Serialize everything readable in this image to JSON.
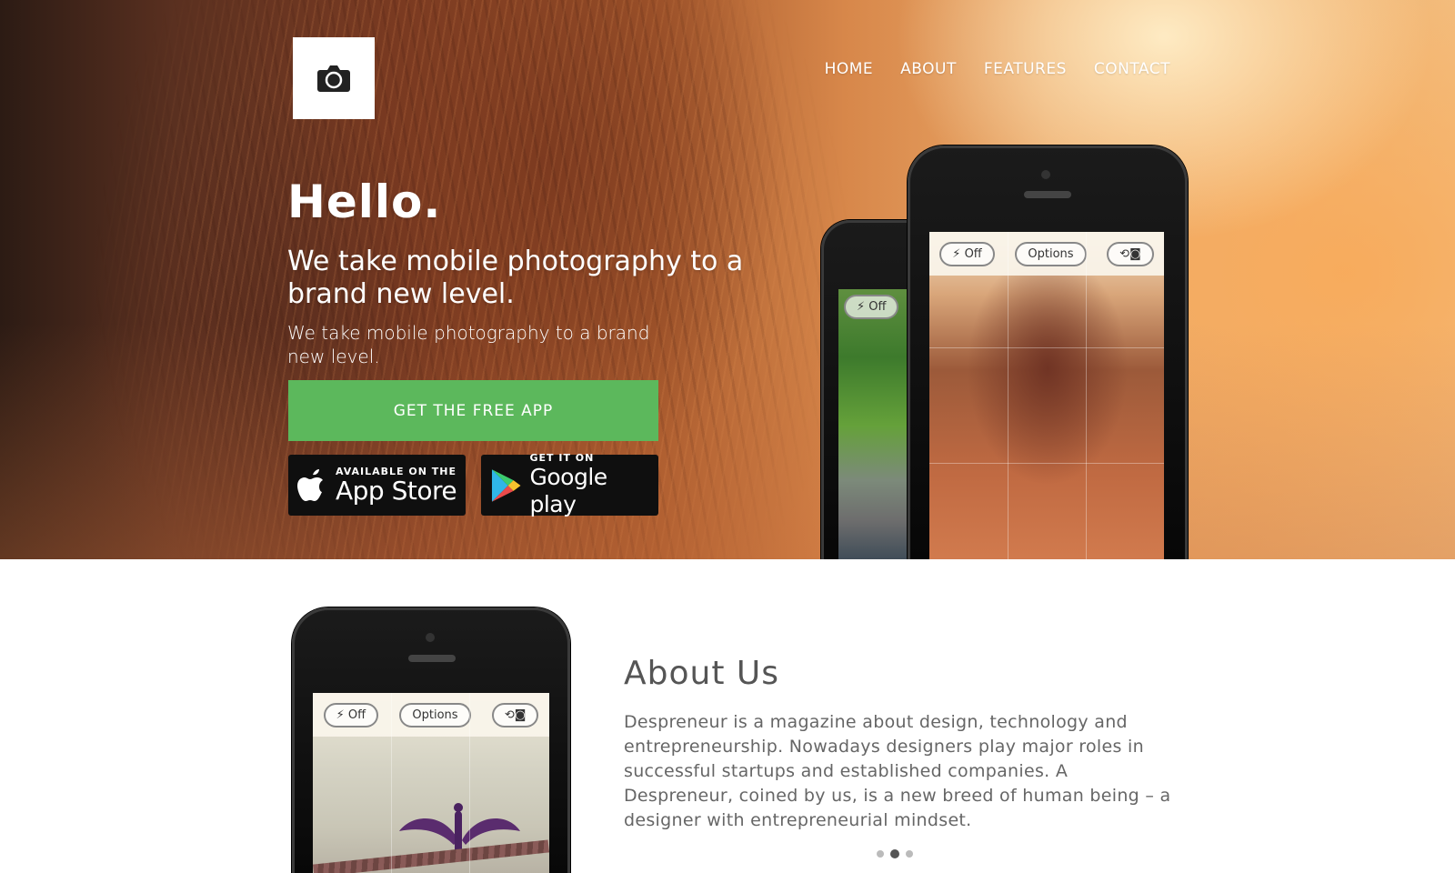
{
  "nav": {
    "items": [
      {
        "label": "HOME"
      },
      {
        "label": "ABOUT"
      },
      {
        "label": "FEATURES"
      },
      {
        "label": "CONTACT"
      }
    ]
  },
  "hero": {
    "title": "Hello.",
    "headline": "We take mobile photography to a brand new level.",
    "subline": "We take mobile photography to a brand new level.",
    "cta_label": "GET THE FREE APP",
    "app_store": {
      "small": "AVAILABLE ON THE",
      "big": "App Store"
    },
    "google_play": {
      "small": "GET IT ON",
      "big": "Google play"
    }
  },
  "phones": {
    "flash_label": "Off",
    "options_label": "Options"
  },
  "about": {
    "title": "About Us",
    "text": "Despreneur is a magazine about design, technology and entrepreneurship. Nowadays designers play major roles in successful startups and established companies. A Despreneur, coined by us, is a new breed of human being – a designer with entrepreneurial mindset.",
    "carousel_active_index": 1,
    "carousel_count": 3
  },
  "colors": {
    "cta": "#5cb85c",
    "store_bg": "#0f0f0f",
    "heading_gray": "#555555"
  },
  "icons": [
    "camera-icon",
    "apple-icon",
    "google-play-icon",
    "flash-icon",
    "switch-camera-icon"
  ]
}
